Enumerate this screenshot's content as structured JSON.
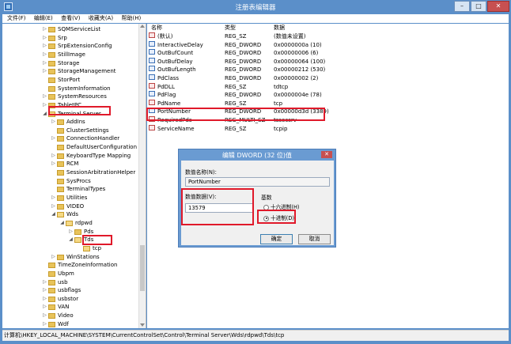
{
  "window": {
    "title": "注册表编辑器"
  },
  "menu": [
    "文件(F)",
    "编辑(E)",
    "查看(V)",
    "收藏夹(A)",
    "帮助(H)"
  ],
  "tree": [
    {
      "label": "SQMServiceList",
      "exp": "▷",
      "open": false
    },
    {
      "label": "Srp",
      "exp": "▷",
      "open": false
    },
    {
      "label": "SrpExtensionConfig",
      "exp": "▷",
      "open": false
    },
    {
      "label": "StillImage",
      "exp": "▷",
      "open": false
    },
    {
      "label": "Storage",
      "exp": "▷",
      "open": false
    },
    {
      "label": "StorageManagement",
      "exp": "▷",
      "open": false
    },
    {
      "label": "StorPort",
      "exp": "",
      "open": false
    },
    {
      "label": "SystemInformation",
      "exp": "",
      "open": false
    },
    {
      "label": "SystemResources",
      "exp": "▷",
      "open": false
    },
    {
      "label": "TabletPC",
      "exp": "▷",
      "open": false
    },
    {
      "label": "Terminal Server",
      "exp": "◢",
      "open": true
    },
    {
      "label": "AddIns",
      "exp": "▷",
      "open": false
    },
    {
      "label": "ClusterSettings",
      "exp": "",
      "open": false
    },
    {
      "label": "ConnectionHandler",
      "exp": "▷",
      "open": false
    },
    {
      "label": "DefaultUserConfiguration",
      "exp": "",
      "open": false
    },
    {
      "label": "KeyboardType Mapping",
      "exp": "▷",
      "open": false
    },
    {
      "label": "RCM",
      "exp": "▷",
      "open": false
    },
    {
      "label": "SessionArbitrationHelper",
      "exp": "",
      "open": false
    },
    {
      "label": "SysProcs",
      "exp": "",
      "open": false
    },
    {
      "label": "TerminalTypes",
      "exp": "",
      "open": false
    },
    {
      "label": "Utilities",
      "exp": "▷",
      "open": false
    },
    {
      "label": "VIDEO",
      "exp": "▷",
      "open": false
    },
    {
      "label": "Wds",
      "exp": "◢",
      "open": true
    },
    {
      "label": "rdpwd",
      "exp": "◢",
      "open": true
    },
    {
      "label": "Pds",
      "exp": "▷",
      "open": false
    },
    {
      "label": "Tds",
      "exp": "◢",
      "open": true
    },
    {
      "label": "tcp",
      "exp": "",
      "open": true
    },
    {
      "label": "WinStations",
      "exp": "▷",
      "open": false
    },
    {
      "label": "TimeZoneInformation",
      "exp": "",
      "open": false
    },
    {
      "label": "Ubpm",
      "exp": "",
      "open": false
    },
    {
      "label": "usb",
      "exp": "▷",
      "open": false
    },
    {
      "label": "usbflags",
      "exp": "▷",
      "open": false
    },
    {
      "label": "usbstor",
      "exp": "▷",
      "open": false
    },
    {
      "label": "VAN",
      "exp": "▷",
      "open": false
    },
    {
      "label": "Video",
      "exp": "▷",
      "open": false
    },
    {
      "label": "Wdf",
      "exp": "▷",
      "open": false
    }
  ],
  "list": {
    "headers": [
      "名称",
      "类型",
      "数据"
    ],
    "rows": [
      {
        "name": "(默认)",
        "type": "REG_SZ",
        "data": "(数值未设置)",
        "icon": "string-value-icon"
      },
      {
        "name": "InteractiveDelay",
        "type": "REG_DWORD",
        "data": "0x0000000a (10)",
        "icon": "binary-value-icon"
      },
      {
        "name": "OutBufCount",
        "type": "REG_DWORD",
        "data": "0x00000006 (6)",
        "icon": "binary-value-icon"
      },
      {
        "name": "OutBufDelay",
        "type": "REG_DWORD",
        "data": "0x00000064 (100)",
        "icon": "binary-value-icon"
      },
      {
        "name": "OutBufLength",
        "type": "REG_DWORD",
        "data": "0x00000212 (530)",
        "icon": "binary-value-icon"
      },
      {
        "name": "PdClass",
        "type": "REG_DWORD",
        "data": "0x00000002 (2)",
        "icon": "binary-value-icon"
      },
      {
        "name": "PdDLL",
        "type": "REG_SZ",
        "data": "tdtcp",
        "icon": "string-value-icon"
      },
      {
        "name": "PdFlag",
        "type": "REG_DWORD",
        "data": "0x0000004e (78)",
        "icon": "binary-value-icon"
      },
      {
        "name": "PdName",
        "type": "REG_SZ",
        "data": "tcp",
        "icon": "string-value-icon"
      },
      {
        "name": "PortNumber",
        "type": "REG_DWORD",
        "data": "0x00000d3d (3389)",
        "icon": "binary-value-icon"
      },
      {
        "name": "RequiredPds",
        "type": "REG_MULTI_SZ",
        "data": "tssecsrv",
        "icon": "string-value-icon"
      },
      {
        "name": "ServiceName",
        "type": "REG_SZ",
        "data": "tcpip",
        "icon": "string-value-icon"
      }
    ]
  },
  "dialog": {
    "title": "编辑 DWORD (32 位)值",
    "name_label": "数值名称(N):",
    "name_value": "PortNumber",
    "data_label": "数值数据(V):",
    "data_value": "13579",
    "base_label": "基数",
    "hex_label": "十六进制(H)",
    "dec_label": "十进制(D)",
    "base_selected": "十进制(D)",
    "ok_label": "确定",
    "cancel_label": "取消"
  },
  "statusbar": {
    "path": "计算机\\HKEY_LOCAL_MACHINE\\SYSTEM\\CurrentControlSet\\Control\\Terminal Server\\Wds\\rdpwd\\Tds\\tcp"
  },
  "colors": {
    "title_bar": "#5b8fc9",
    "highlight": "#e0192a",
    "folder": "#e8c35a"
  }
}
